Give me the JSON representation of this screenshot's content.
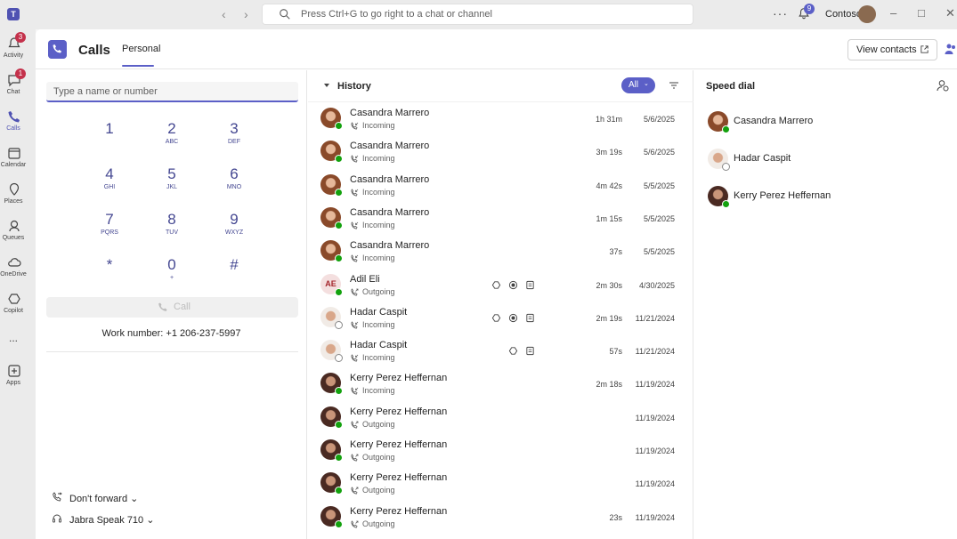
{
  "titlebar": {
    "search_placeholder": "Press Ctrl+G to go right to a chat or channel",
    "notification_count": "9",
    "org_name": "Contoso",
    "logo_letter": "T"
  },
  "rail": {
    "items": [
      {
        "label": "Activity",
        "icon": "bell-icon",
        "badge": "3"
      },
      {
        "label": "Chat",
        "icon": "chat-icon",
        "badge": "1"
      },
      {
        "label": "Calls",
        "icon": "phone-icon",
        "badge": ""
      },
      {
        "label": "Calendar",
        "icon": "calendar-icon",
        "badge": ""
      },
      {
        "label": "Places",
        "icon": "places-icon",
        "badge": ""
      },
      {
        "label": "Queues",
        "icon": "queues-icon",
        "badge": ""
      },
      {
        "label": "OneDrive",
        "icon": "cloud-icon",
        "badge": ""
      },
      {
        "label": "Copilot",
        "icon": "copilot-icon",
        "badge": ""
      },
      {
        "label": "...",
        "icon": "more-icon",
        "badge": ""
      },
      {
        "label": "Apps",
        "icon": "apps-icon",
        "badge": ""
      }
    ]
  },
  "header": {
    "title": "Calls",
    "tab": "Personal",
    "view_contacts": "View contacts"
  },
  "dialpad": {
    "placeholder": "Type a name or number",
    "keys": [
      {
        "digit": "1",
        "sub": ""
      },
      {
        "digit": "2",
        "sub": "ABC"
      },
      {
        "digit": "3",
        "sub": "DEF"
      },
      {
        "digit": "4",
        "sub": "GHI"
      },
      {
        "digit": "5",
        "sub": "JKL"
      },
      {
        "digit": "6",
        "sub": "MNO"
      },
      {
        "digit": "7",
        "sub": "PQRS"
      },
      {
        "digit": "8",
        "sub": "TUV"
      },
      {
        "digit": "9",
        "sub": "WXYZ"
      },
      {
        "digit": "*",
        "sub": ""
      },
      {
        "digit": "0",
        "sub": "+"
      },
      {
        "digit": "#",
        "sub": ""
      }
    ],
    "call_label": "Call",
    "work_number": "Work number: +1 206-237-5997",
    "forward_label": "Don't forward",
    "device_label": "Jabra Speak 710"
  },
  "history": {
    "title": "History",
    "filter": "All",
    "calls": [
      {
        "name": "Casandra Marrero",
        "direction": "Incoming",
        "duration": "1h 31m",
        "date": "5/6/2025",
        "avatar": "cas",
        "presence": "available",
        "actions": []
      },
      {
        "name": "Casandra Marrero",
        "direction": "Incoming",
        "duration": "3m 19s",
        "date": "5/6/2025",
        "avatar": "cas",
        "presence": "available",
        "actions": []
      },
      {
        "name": "Casandra Marrero",
        "direction": "Incoming",
        "duration": "4m 42s",
        "date": "5/5/2025",
        "avatar": "cas",
        "presence": "available",
        "actions": []
      },
      {
        "name": "Casandra Marrero",
        "direction": "Incoming",
        "duration": "1m 15s",
        "date": "5/5/2025",
        "avatar": "cas",
        "presence": "available",
        "actions": []
      },
      {
        "name": "Casandra Marrero",
        "direction": "Incoming",
        "duration": "37s",
        "date": "5/5/2025",
        "avatar": "cas",
        "presence": "available",
        "actions": []
      },
      {
        "name": "Adil Eli",
        "direction": "Outgoing",
        "duration": "2m 30s",
        "date": "4/30/2025",
        "avatar": "ae",
        "initials": "AE",
        "presence": "available",
        "actions": [
          "copilot-icon",
          "recording-icon",
          "transcript-icon"
        ]
      },
      {
        "name": "Hadar Caspit",
        "direction": "Incoming",
        "duration": "2m 19s",
        "date": "11/21/2024",
        "avatar": "hadar",
        "presence": "offline",
        "actions": [
          "copilot-icon",
          "recording-icon",
          "transcript-icon"
        ]
      },
      {
        "name": "Hadar Caspit",
        "direction": "Incoming",
        "duration": "57s",
        "date": "11/21/2024",
        "avatar": "hadar",
        "presence": "offline",
        "actions": [
          "copilot-icon",
          "transcript-icon"
        ]
      },
      {
        "name": "Kerry Perez Heffernan",
        "direction": "Incoming",
        "duration": "2m 18s",
        "date": "11/19/2024",
        "avatar": "kerry",
        "presence": "available",
        "actions": []
      },
      {
        "name": "Kerry Perez Heffernan",
        "direction": "Outgoing",
        "duration": "",
        "date": "11/19/2024",
        "avatar": "kerry",
        "presence": "available",
        "actions": []
      },
      {
        "name": "Kerry Perez Heffernan",
        "direction": "Outgoing",
        "duration": "",
        "date": "11/19/2024",
        "avatar": "kerry",
        "presence": "available",
        "actions": []
      },
      {
        "name": "Kerry Perez Heffernan",
        "direction": "Outgoing",
        "duration": "",
        "date": "11/19/2024",
        "avatar": "kerry",
        "presence": "available",
        "actions": []
      },
      {
        "name": "Kerry Perez Heffernan",
        "direction": "Outgoing",
        "duration": "23s",
        "date": "11/19/2024",
        "avatar": "kerry",
        "presence": "available",
        "actions": []
      }
    ]
  },
  "speed_dial": {
    "title": "Speed dial",
    "contacts": [
      {
        "name": "Casandra Marrero",
        "avatar": "cas",
        "presence": "available"
      },
      {
        "name": "Hadar Caspit",
        "avatar": "hadar",
        "presence": "offline"
      },
      {
        "name": "Kerry Perez Heffernan",
        "avatar": "kerry",
        "presence": "available"
      }
    ]
  },
  "colors": {
    "accent": "#5b5fc7",
    "accent_dark": "#444791",
    "presence_available": "#13a10e",
    "badge_red": "#c4314b"
  }
}
